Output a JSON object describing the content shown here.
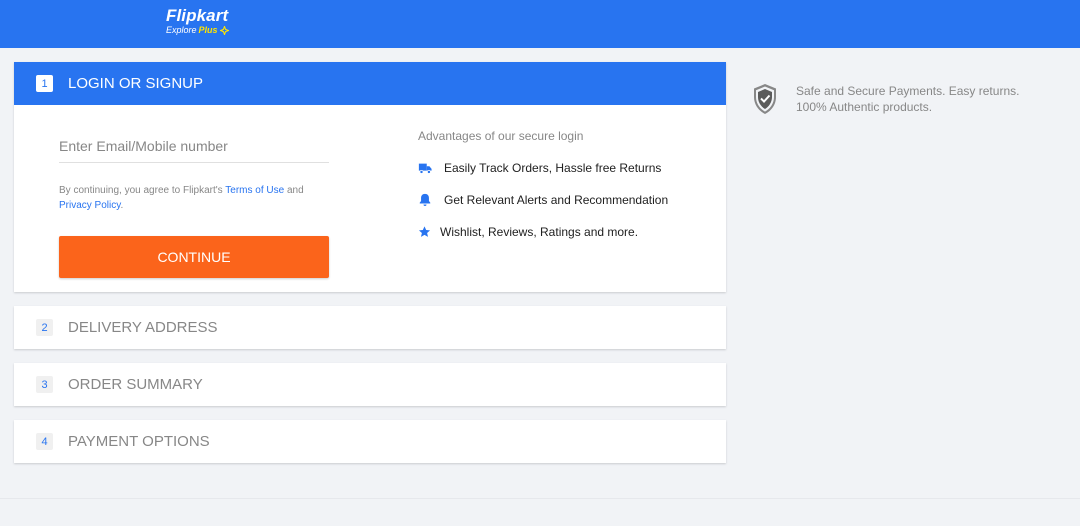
{
  "header": {
    "logo_name": "Flipkart",
    "logo_explore": "Explore",
    "logo_plus": "Plus",
    "brand_color": "#2874f0"
  },
  "login": {
    "step_number": "1",
    "title": "LOGIN OR SIGNUP",
    "email_placeholder": "Enter Email/Mobile number",
    "terms_prefix": "By continuing, you agree to Flipkart's ",
    "terms_link": "Terms of Use",
    "terms_and": " and",
    "privacy_link": "Privacy Policy",
    "terms_suffix": ".",
    "continue_label": "CONTINUE",
    "continue_color": "#fb641b",
    "advantages_title": "Advantages of our secure login",
    "advantages": [
      {
        "icon": "truck-icon",
        "label": "Easily Track Orders, Hassle free Returns"
      },
      {
        "icon": "bell-icon",
        "label": "Get Relevant Alerts and Recommendation"
      },
      {
        "icon": "star-icon",
        "label": "Wishlist, Reviews, Ratings and more."
      }
    ]
  },
  "steps": [
    {
      "number": "2",
      "title": "DELIVERY ADDRESS"
    },
    {
      "number": "3",
      "title": "ORDER SUMMARY"
    },
    {
      "number": "4",
      "title": "PAYMENT OPTIONS"
    }
  ],
  "secure": {
    "icon": "shield-check-icon",
    "text": "Safe and Secure Payments. Easy returns. 100% Authentic products."
  }
}
